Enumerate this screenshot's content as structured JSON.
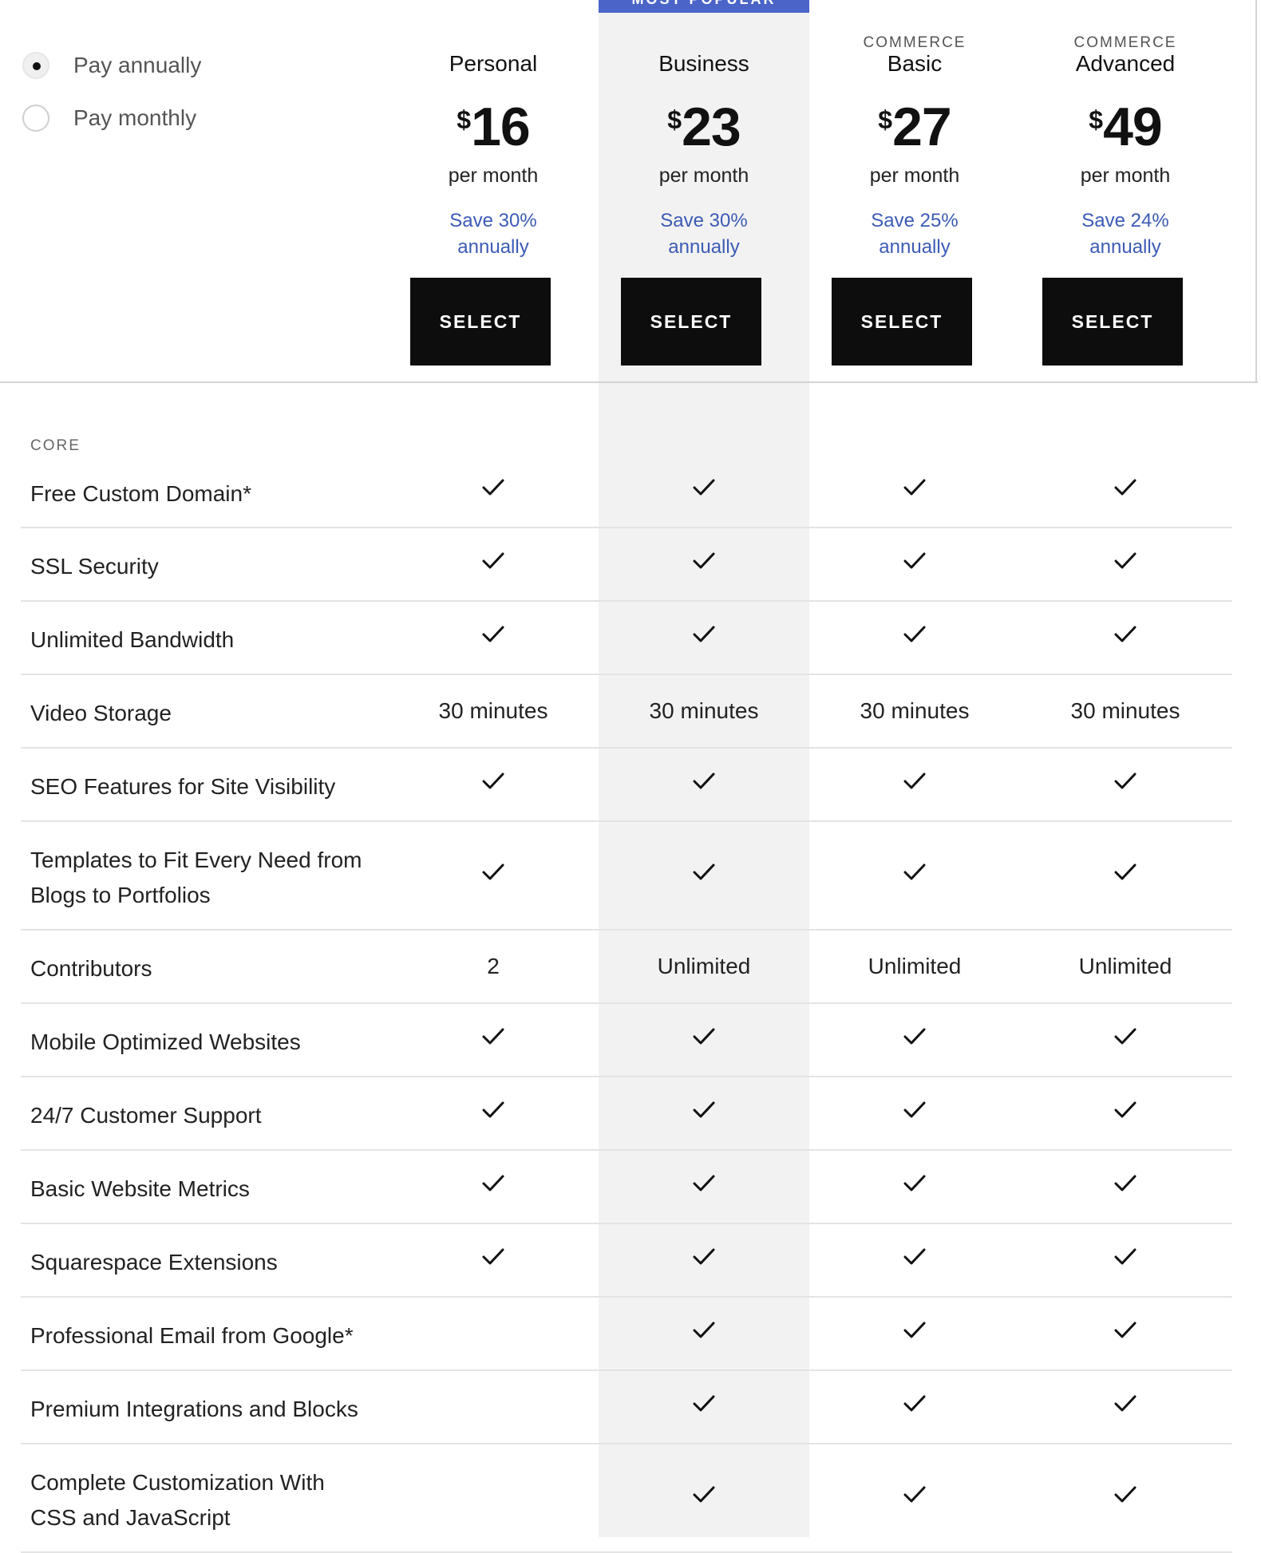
{
  "popular_label": "MOST POPULAR",
  "billing": {
    "options": [
      {
        "label": "Pay annually",
        "selected": true
      },
      {
        "label": "Pay monthly",
        "selected": false
      }
    ]
  },
  "plans": [
    {
      "eyebrow": "",
      "name": "Personal",
      "currency": "$",
      "price": "16",
      "per": "per month",
      "save_line1": "Save 30%",
      "save_line2": "annually",
      "button": "SELECT"
    },
    {
      "eyebrow": "",
      "name": "Business",
      "currency": "$",
      "price": "23",
      "per": "per month",
      "save_line1": "Save 30%",
      "save_line2": "annually",
      "button": "SELECT"
    },
    {
      "eyebrow": "COMMERCE",
      "name": "Basic",
      "currency": "$",
      "price": "27",
      "per": "per month",
      "save_line1": "Save 25%",
      "save_line2": "annually",
      "button": "SELECT"
    },
    {
      "eyebrow": "COMMERCE",
      "name": "Advanced",
      "currency": "$",
      "price": "49",
      "per": "per month",
      "save_line1": "Save 24%",
      "save_line2": "annually",
      "button": "SELECT"
    }
  ],
  "section_label": "CORE",
  "features": [
    {
      "label_line1": "Free Custom Domain*",
      "label_line2": "",
      "values": [
        "check",
        "check",
        "check",
        "check"
      ]
    },
    {
      "label_line1": "SSL Security",
      "label_line2": "",
      "values": [
        "check",
        "check",
        "check",
        "check"
      ]
    },
    {
      "label_line1": "Unlimited Bandwidth",
      "label_line2": "",
      "values": [
        "check",
        "check",
        "check",
        "check"
      ]
    },
    {
      "label_line1": "Video Storage",
      "label_line2": "",
      "values": [
        "30 minutes",
        "30 minutes",
        "30 minutes",
        "30 minutes"
      ]
    },
    {
      "label_line1": "SEO Features for Site Visibility",
      "label_line2": "",
      "values": [
        "check",
        "check",
        "check",
        "check"
      ]
    },
    {
      "label_line1": "Templates to Fit Every Need from",
      "label_line2": "Blogs to Portfolios",
      "values": [
        "check",
        "check",
        "check",
        "check"
      ]
    },
    {
      "label_line1": "Contributors",
      "label_line2": "",
      "values": [
        "2",
        "Unlimited",
        "Unlimited",
        "Unlimited"
      ]
    },
    {
      "label_line1": "Mobile Optimized Websites",
      "label_line2": "",
      "values": [
        "check",
        "check",
        "check",
        "check"
      ]
    },
    {
      "label_line1": "24/7 Customer Support",
      "label_line2": "",
      "values": [
        "check",
        "check",
        "check",
        "check"
      ]
    },
    {
      "label_line1": "Basic Website Metrics",
      "label_line2": "",
      "values": [
        "check",
        "check",
        "check",
        "check"
      ]
    },
    {
      "label_line1": "Squarespace Extensions",
      "label_line2": "",
      "values": [
        "check",
        "check",
        "check",
        "check"
      ]
    },
    {
      "label_line1": "Professional Email from Google*",
      "label_line2": "",
      "values": [
        "",
        "check",
        "check",
        "check"
      ]
    },
    {
      "label_line1": "Premium Integrations and Blocks",
      "label_line2": "",
      "values": [
        "",
        "check",
        "check",
        "check"
      ]
    },
    {
      "label_line1": "Complete Customization With",
      "label_line2": "CSS and JavaScript",
      "values": [
        "",
        "check",
        "check",
        "check"
      ]
    }
  ],
  "icons": {
    "check": "check-icon",
    "radio_selected": "radio-selected-icon",
    "radio_unselected": "radio-unselected-icon"
  },
  "colors": {
    "accent_blue": "#3b5bb5",
    "popular_tab": "#4a64c8",
    "button_black": "#0d0d0d",
    "highlight_bg": "#f2f2f2"
  }
}
